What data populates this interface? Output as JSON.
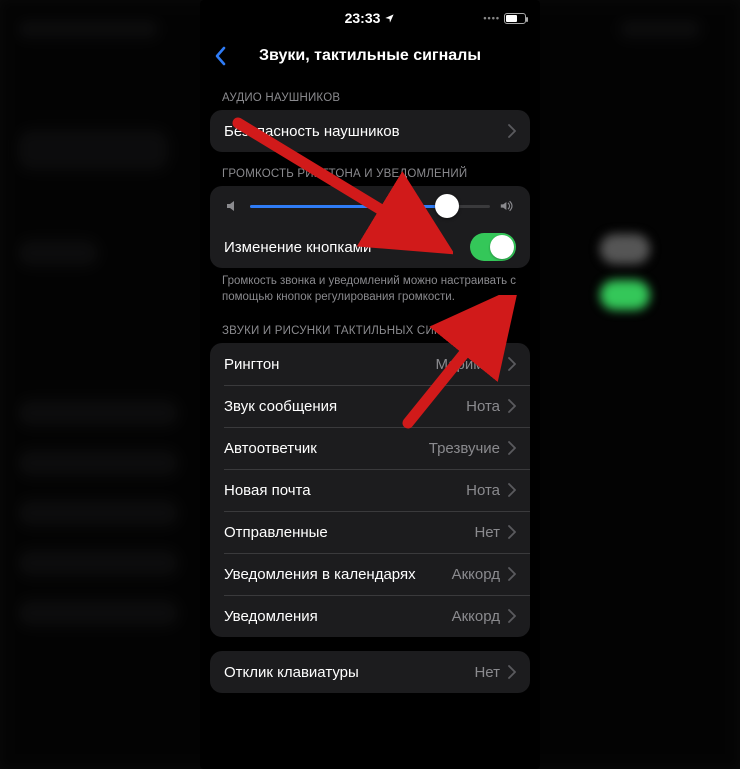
{
  "status": {
    "time": "23:33"
  },
  "nav": {
    "title": "Звуки, тактильные сигналы"
  },
  "sections": {
    "headphones": {
      "header": "АУДИО НАУШНИКОВ",
      "safety": "Безопасность наушников"
    },
    "volume": {
      "header": "ГРОМКОСТЬ РИНГТОНА И УВЕДОМЛЕНИЙ",
      "change_with_buttons": "Изменение кнопками",
      "footer": "Громкость звонка и уведомлений можно настраивать с помощью кнопок регулирования громкости."
    },
    "sounds": {
      "header": "ЗВУКИ И РИСУНКИ ТАКТИЛЬНЫХ СИГНАЛОВ",
      "rows": [
        {
          "label": "Рингтон",
          "value": "Маримба"
        },
        {
          "label": "Звук сообщения",
          "value": "Нота"
        },
        {
          "label": "Автоответчик",
          "value": "Трезвучие"
        },
        {
          "label": "Новая почта",
          "value": "Нота"
        },
        {
          "label": "Отправленные",
          "value": "Нет"
        },
        {
          "label": "Уведомления в календарях",
          "value": "Аккорд"
        },
        {
          "label": "Уведомления",
          "value": "Аккорд"
        }
      ]
    },
    "keyboard": {
      "label": "Отклик клавиатуры",
      "value": "Нет"
    }
  },
  "colors": {
    "accent_blue": "#2f7cf6",
    "toggle_green": "#34c759",
    "arrow_red": "#d11a1a"
  }
}
